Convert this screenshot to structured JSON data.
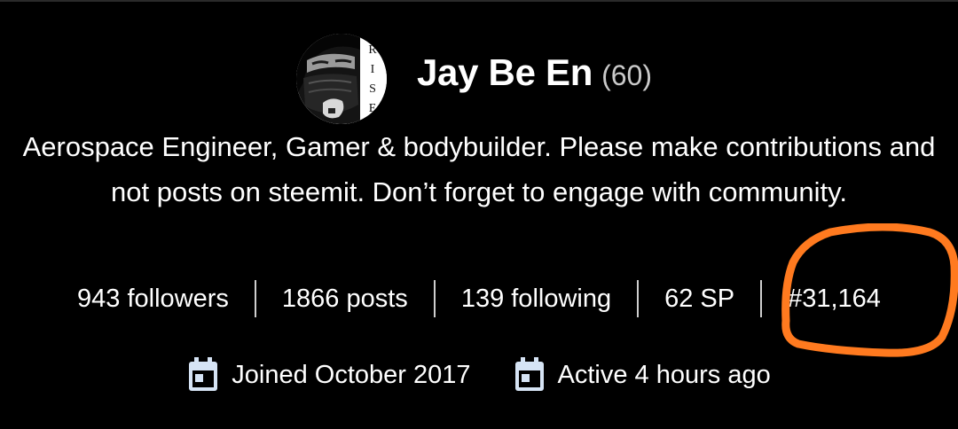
{
  "profile": {
    "name": "Jay Be En",
    "reputation": "(60)",
    "avatar_text": "RISE",
    "bio": "Aerospace Engineer, Gamer & bodybuilder. Please make contributions and not posts on steemit. Don’t forget to engage with community."
  },
  "stats": {
    "followers": "943 followers",
    "posts": "1866 posts",
    "following": "139 following",
    "steem_power": "62 SP",
    "rank": "#31,164"
  },
  "meta": {
    "joined": "Joined October 2017",
    "active": "Active 4 hours ago"
  },
  "icons": {
    "joined_icon": "calendar-icon",
    "active_icon": "calendar-icon"
  },
  "colors": {
    "background": "#000000",
    "text": "#ffffff",
    "reputation": "#c9c9c9",
    "icon": "#d6e4f5",
    "highlight_annotation": "#ff7a1f"
  }
}
